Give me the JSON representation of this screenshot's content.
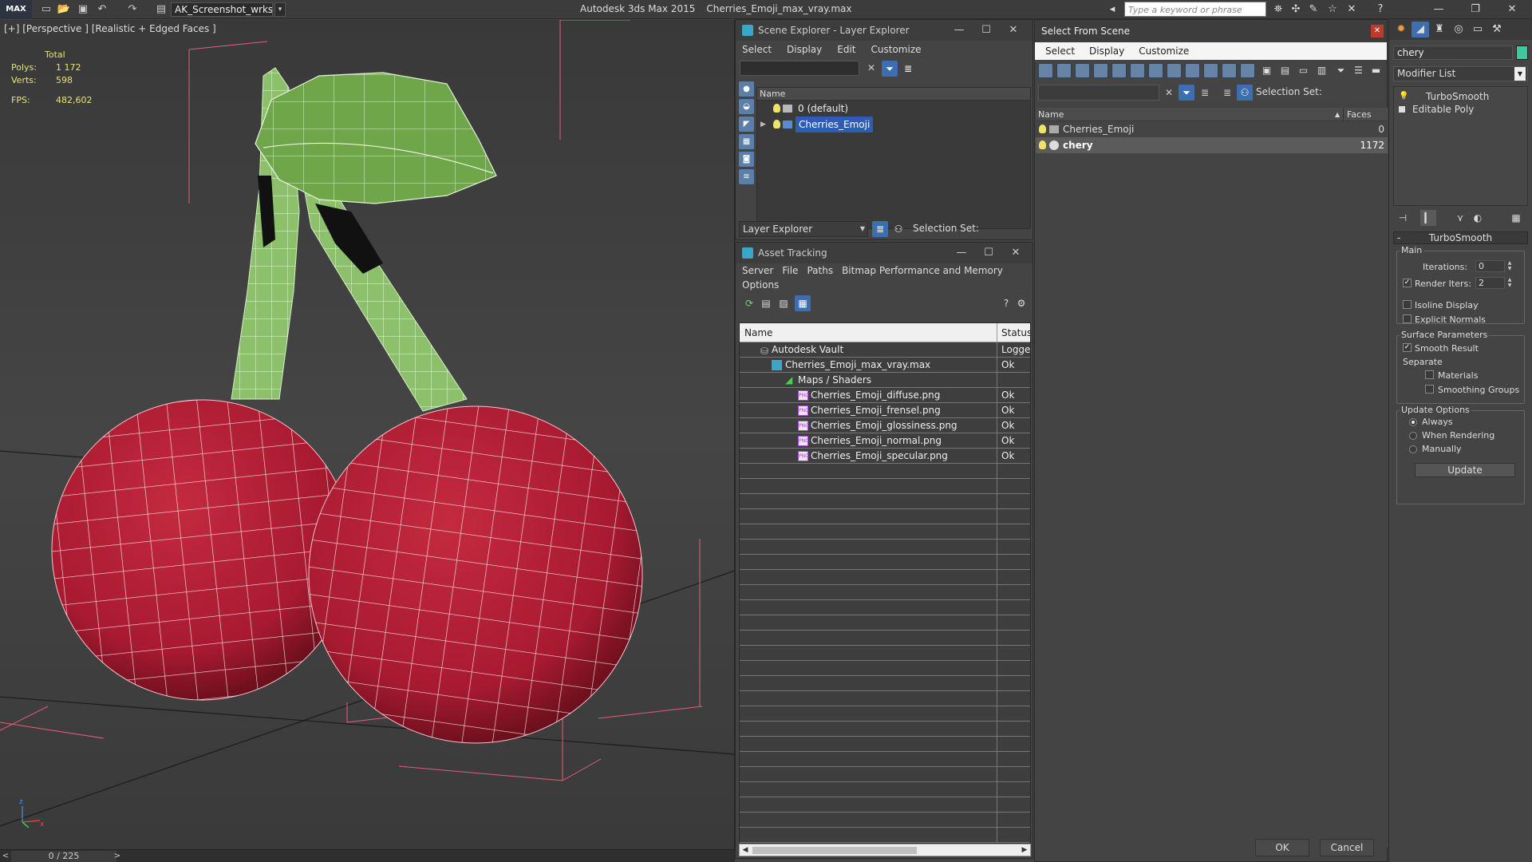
{
  "titlebar": {
    "logo": "MAX",
    "workspace": "AK_Screenshot_wrksp",
    "app_name": "Autodesk 3ds Max  2015",
    "file_name": "Cherries_Emoji_max_vray.max",
    "search_placeholder": "Type a keyword or phrase"
  },
  "viewport": {
    "label": "[+] [Perspective ] [Realistic + Edged Faces ]",
    "stats": {
      "total_label": "Total",
      "polys_label": "Polys:",
      "polys_value": "1 172",
      "verts_label": "Verts:",
      "verts_value": "598",
      "fps_label": "FPS:",
      "fps_value": "482,602"
    },
    "axis_x": "x",
    "axis_z": "z"
  },
  "timeslider": {
    "frame": "0 / 225",
    "prev": "<",
    "next": ">"
  },
  "layer_explorer": {
    "title": "Scene Explorer - Layer Explorer",
    "menu": [
      "Select",
      "Display",
      "Edit",
      "Customize"
    ],
    "column": "Name",
    "rows": [
      "0 (default)",
      "Cherries_Emoji"
    ],
    "footer_combo": "Layer Explorer",
    "selection_set": "Selection Set:"
  },
  "asset_tracking": {
    "title": "Asset Tracking",
    "menu": [
      "Server",
      "File",
      "Paths",
      "Bitmap Performance and Memory",
      "Options"
    ],
    "columns": {
      "name": "Name",
      "status": "Status"
    },
    "rows": [
      {
        "name": "Autodesk Vault",
        "status": "Logged"
      },
      {
        "name": "Cherries_Emoji_max_vray.max",
        "status": "Ok"
      },
      {
        "name": "Maps / Shaders",
        "status": ""
      },
      {
        "name": "Cherries_Emoji_diffuse.png",
        "status": "Ok"
      },
      {
        "name": "Cherries_Emoji_frensel.png",
        "status": "Ok"
      },
      {
        "name": "Cherries_Emoji_glossiness.png",
        "status": "Ok"
      },
      {
        "name": "Cherries_Emoji_normal.png",
        "status": "Ok"
      },
      {
        "name": "Cherries_Emoji_specular.png",
        "status": "Ok"
      }
    ],
    "png_badge": "PNG"
  },
  "select_from_scene": {
    "title": "Select From Scene",
    "menu": [
      "Select",
      "Display",
      "Customize"
    ],
    "selection_set": "Selection Set:",
    "columns": {
      "name": "Name",
      "faces": "Faces"
    },
    "rows": [
      {
        "name": "Cherries_Emoji",
        "faces": "0"
      },
      {
        "name": "chery",
        "faces": "1172"
      }
    ],
    "ok": "OK",
    "cancel": "Cancel"
  },
  "command_panel": {
    "object_name": "chery",
    "object_color": "#3fc8a0",
    "modifier_list": "Modifier List",
    "stack": [
      "TurboSmooth",
      "Editable Poly"
    ],
    "rollout": "TurboSmooth",
    "main": {
      "group": "Main",
      "iterations_label": "Iterations:",
      "iterations": "0",
      "render_iters_label": "Render Iters:",
      "render_iters": "2",
      "isoline": "Isoline Display",
      "explicit_normals": "Explicit Normals"
    },
    "surface": {
      "group": "Surface Parameters",
      "smooth_result": "Smooth Result",
      "separate": "Separate",
      "materials": "Materials",
      "smoothing_groups": "Smoothing Groups"
    },
    "update": {
      "group": "Update Options",
      "always": "Always",
      "when_rendering": "When Rendering",
      "manually": "Manually",
      "button": "Update"
    }
  },
  "colors": {
    "cherry": "#b01c32",
    "leaf": "#6fa64a",
    "stem": "#8cc06a",
    "selection": "#2e5bb3",
    "bulb": "#f0e36a",
    "stat_text": "#e9e27a"
  }
}
